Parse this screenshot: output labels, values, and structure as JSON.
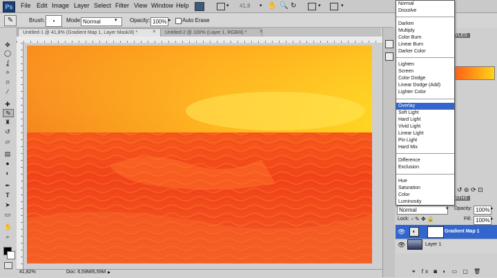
{
  "app": {
    "logo": "Ps"
  },
  "menu": [
    "File",
    "Edit",
    "Image",
    "Layer",
    "Select",
    "Filter",
    "View",
    "Window",
    "Help"
  ],
  "appbar": {
    "zoom": "41,8"
  },
  "options": {
    "brush_label": "Brush:",
    "mode_label": "Mode:",
    "mode_value": "Normal",
    "opacity_label": "Opacity:",
    "opacity_value": "100%",
    "auto_erase_label": "Auto Erase"
  },
  "tabs": [
    {
      "label": "Untitled-1 @ 41,8% (Gradient Map 1, Layer Mask/8) *"
    },
    {
      "label": "Untitled-2 @ 100% (Layer 1, RGB/8) *"
    }
  ],
  "status": {
    "zoom": "41,82%",
    "doc": "Doc: 6,59M/6,59M"
  },
  "blend_modes": {
    "groups": [
      [
        "Normal",
        "Dissolve"
      ],
      [
        "Darken",
        "Multiply",
        "Color Burn",
        "Linear Burn",
        "Darker Color"
      ],
      [
        "Lighten",
        "Screen",
        "Color Dodge",
        "Linear Dodge (Add)",
        "Lighter Color"
      ],
      [
        "Overlay",
        "Soft Light",
        "Hard Light",
        "Vivid Light",
        "Linear Light",
        "Pin Light",
        "Hard Mix"
      ],
      [
        "Difference",
        "Exclusion"
      ],
      [
        "Hue",
        "Saturation",
        "Color",
        "Luminosity"
      ]
    ],
    "selected": "Overlay"
  },
  "panel": {
    "tab_partial": "YLES",
    "layers_tab_partial": "ATHS",
    "blend_value": "Normal",
    "opacity_label": "Opacity:",
    "opacity_value": "100%",
    "lock_label": "Lock:",
    "fill_label": "Fill:",
    "fill_value": "100%",
    "layers": [
      {
        "name": "Gradient Map 1",
        "selected": true
      },
      {
        "name": "Layer 1",
        "selected": false
      }
    ]
  },
  "colors": {
    "accent_selection": "#3366cc",
    "sea_dark": "#f0401c",
    "sky_light": "#ffd21a"
  }
}
